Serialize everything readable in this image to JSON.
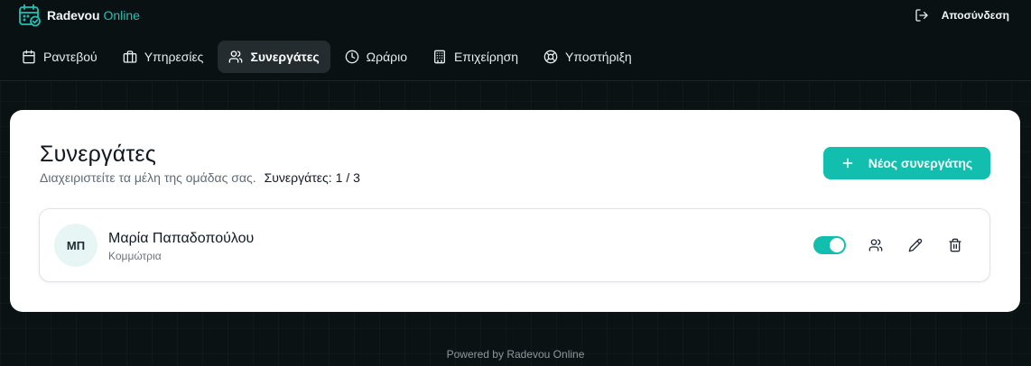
{
  "brand": {
    "name": "Radevou",
    "suffix": "Online",
    "logo_icon": "calendar-check-icon"
  },
  "header": {
    "logout_label": "Αποσύνδεση",
    "logout_icon": "log-out-icon"
  },
  "nav": {
    "items": [
      {
        "label": "Ραντεβού",
        "icon": "calendar-icon",
        "active": false
      },
      {
        "label": "Υπηρεσίες",
        "icon": "briefcase-icon",
        "active": false
      },
      {
        "label": "Συνεργάτες",
        "icon": "users-icon",
        "active": true
      },
      {
        "label": "Ωράριο",
        "icon": "clock-icon",
        "active": false
      },
      {
        "label": "Επιχείρηση",
        "icon": "building-icon",
        "active": false
      },
      {
        "label": "Υποστήριξη",
        "icon": "lifebuoy-icon",
        "active": false
      }
    ]
  },
  "page": {
    "title": "Συνεργάτες",
    "subtitle": "Διαχειριστείτε τα μέλη της ομάδας σας.",
    "count_label": "Συνεργάτες:",
    "count_value": "1 / 3",
    "new_button_label": "Νέος συνεργάτης"
  },
  "members": [
    {
      "initials": "ΜΠ",
      "name": "Μαρία Παπαδοπούλου",
      "role": "Κομμώτρια",
      "active": true
    }
  ],
  "footer": {
    "text": "Powered by Radevou Online"
  },
  "colors": {
    "accent": "#12bfae",
    "background": "#0b1214",
    "card": "#ffffff"
  }
}
